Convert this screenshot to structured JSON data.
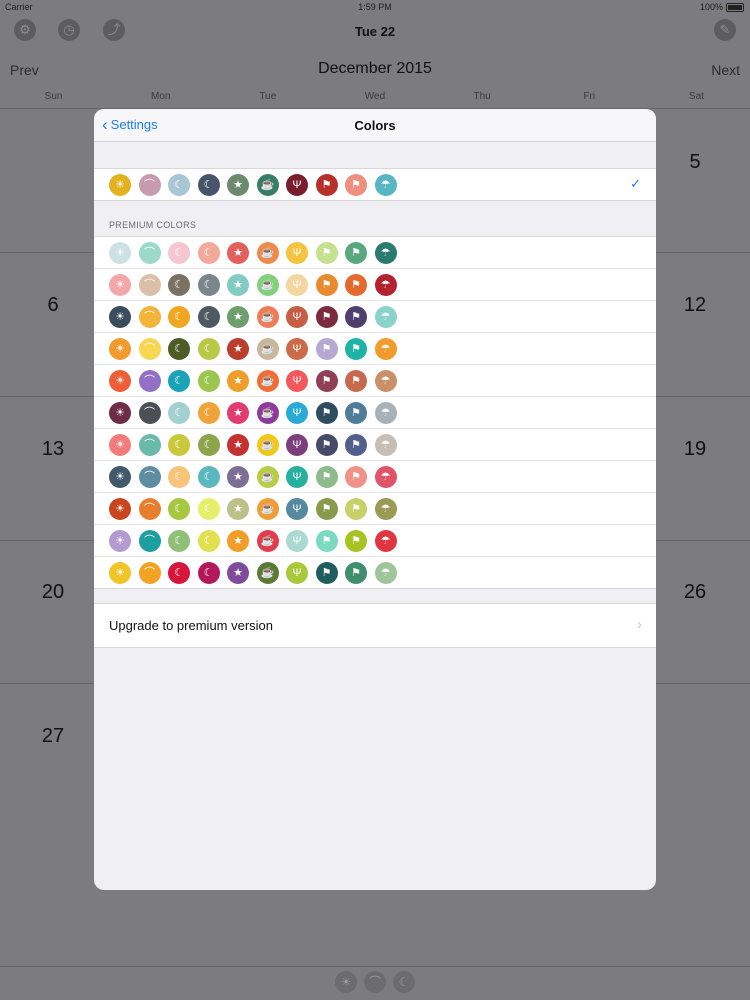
{
  "status": {
    "carrier": "Carrier",
    "time": "1:59 PM",
    "battery": "100%"
  },
  "toolbar": {
    "date": "Tue 22",
    "left_icons": [
      "gear-icon",
      "clock-icon",
      "share-icon"
    ],
    "right_icon": "brush-icon"
  },
  "calendar": {
    "prev": "Prev",
    "next": "Next",
    "month": "December 2015",
    "weekdays": [
      "Sun",
      "Mon",
      "Tue",
      "Wed",
      "Thu",
      "Fri",
      "Sat"
    ],
    "days": [
      "5",
      "6",
      "12",
      "13",
      "19",
      "20",
      "26",
      "27"
    ]
  },
  "modal": {
    "back_label": "Settings",
    "title": "Colors",
    "premium_header": "PREMIUM COLORS",
    "upgrade_label": "Upgrade to premium version",
    "icon_glyphs": [
      "☀",
      "⌒",
      "☾",
      "☾",
      "★",
      "☕",
      "Ψ",
      "⚑",
      "⚑",
      "☂"
    ],
    "icon_names": [
      "sun-icon",
      "sunrise-icon",
      "moon-icon",
      "moon-cloud-icon",
      "star-icon",
      "cup-icon",
      "cutlery-icon",
      "runner-icon",
      "sprinter-icon",
      "umbrella-icon"
    ],
    "selected_row": [
      "#e3b21f",
      "#c89ab0",
      "#a9c6d6",
      "#47546c",
      "#6d8b6c",
      "#3a7d66",
      "#7a1e2e",
      "#b5312a",
      "#ef8f80",
      "#58b6c4"
    ],
    "premium_rows": [
      [
        "#cde0e5",
        "#9cd9c8",
        "#f5c6d0",
        "#f3a99a",
        "#e4605c",
        "#ef8a4c",
        "#f4c440",
        "#c5e08f",
        "#59a77f",
        "#2a7a70"
      ],
      [
        "#f4a7a8",
        "#dcbfa8",
        "#7b7263",
        "#79868c",
        "#82cbc4",
        "#84d17b",
        "#f3d6a0",
        "#e88a2f",
        "#e36a2c",
        "#b3222e"
      ],
      [
        "#3a4d5d",
        "#f2b43a",
        "#f0a621",
        "#4d5a63",
        "#6d9e6c",
        "#ef7c56",
        "#c65d45",
        "#7c2a3e",
        "#4e3f6f",
        "#8ad3cc"
      ],
      [
        "#f19a2d",
        "#f6d653",
        "#4f5c27",
        "#b8c945",
        "#b93e2b",
        "#c9b69b",
        "#cc6b4a",
        "#b6a8d3",
        "#1fb3a8",
        "#f09b2b"
      ],
      [
        "#ee5f38",
        "#9270c6",
        "#1aa3b8",
        "#9bc750",
        "#ef9e2b",
        "#ef6e36",
        "#f2585c",
        "#903f56",
        "#c8694e",
        "#c9906a"
      ],
      [
        "#6d2d46",
        "#4e4f56",
        "#a3cfd0",
        "#efa43a",
        "#e13c6f",
        "#8d3a9a",
        "#2aaad6",
        "#2e4e60",
        "#4e7c9a",
        "#a8b0b8"
      ],
      [
        "#f37b7a",
        "#6abaa9",
        "#c8c83a",
        "#8ca44a",
        "#c33131",
        "#f3c61e",
        "#7a3f7c",
        "#454b68",
        "#54608c",
        "#c8beb3"
      ],
      [
        "#405a6c",
        "#5e8da2",
        "#f7c47a",
        "#5db7c0",
        "#7c6e95",
        "#b6cd45",
        "#28b09c",
        "#8dbb8b",
        "#f19288",
        "#e0546a"
      ],
      [
        "#c8461f",
        "#e77e2d",
        "#a7c741",
        "#e7ee6a",
        "#bdc089",
        "#f19c37",
        "#5489a0",
        "#8a9a4c",
        "#c7d168",
        "#9b9b55"
      ],
      [
        "#b39ad0",
        "#1d9ea0",
        "#90c078",
        "#e1e04f",
        "#f29d27",
        "#e33b4a",
        "#a9d9d0",
        "#7adbc2",
        "#a5c322",
        "#e03642"
      ],
      [
        "#f1c528",
        "#f2a324",
        "#d8153a",
        "#b5185a",
        "#7f4b9b",
        "#5b7a33",
        "#a8c93a",
        "#1f5d5f",
        "#3f8e6c",
        "#9fc59c"
      ]
    ]
  }
}
